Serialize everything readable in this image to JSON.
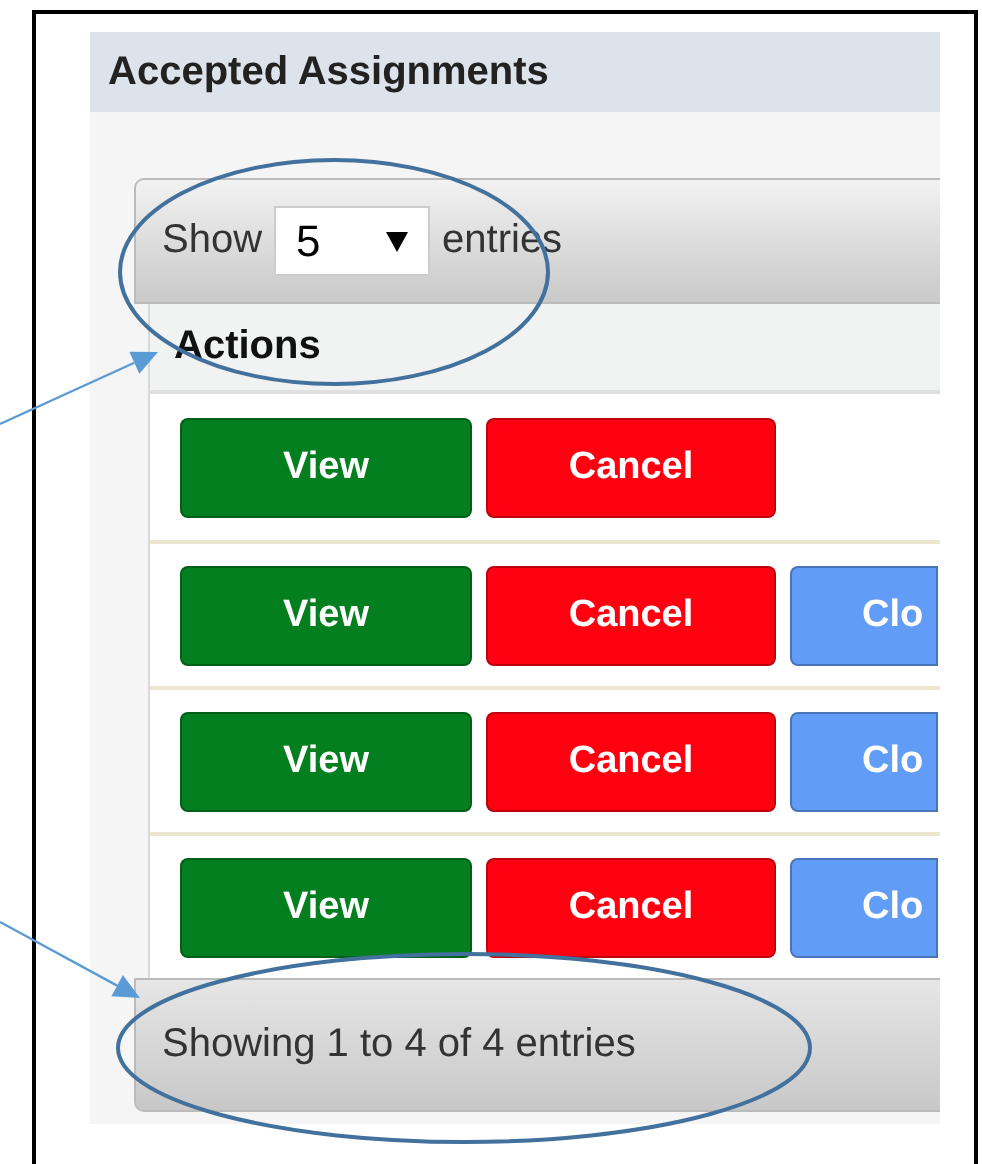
{
  "panel": {
    "title": "Accepted Assignments"
  },
  "length_control": {
    "before": "Show",
    "value": "5",
    "after": "entries",
    "circled": true
  },
  "table": {
    "columns": [
      "Actions"
    ],
    "header_arrow": true,
    "rows": [
      {
        "buttons": [
          {
            "kind": "view",
            "label": "View"
          },
          {
            "kind": "cancel",
            "label": "Cancel"
          }
        ]
      },
      {
        "buttons": [
          {
            "kind": "view",
            "label": "View"
          },
          {
            "kind": "cancel",
            "label": "Cancel"
          },
          {
            "kind": "close",
            "label": "Clo"
          }
        ]
      },
      {
        "buttons": [
          {
            "kind": "view",
            "label": "View"
          },
          {
            "kind": "cancel",
            "label": "Cancel"
          },
          {
            "kind": "close",
            "label": "Clo"
          }
        ]
      },
      {
        "buttons": [
          {
            "kind": "view",
            "label": "View"
          },
          {
            "kind": "cancel",
            "label": "Cancel"
          },
          {
            "kind": "close",
            "label": "Clo"
          }
        ]
      }
    ]
  },
  "info": {
    "text": "Showing 1 to 4 of 4 entries",
    "circled": true,
    "arrow": true
  }
}
